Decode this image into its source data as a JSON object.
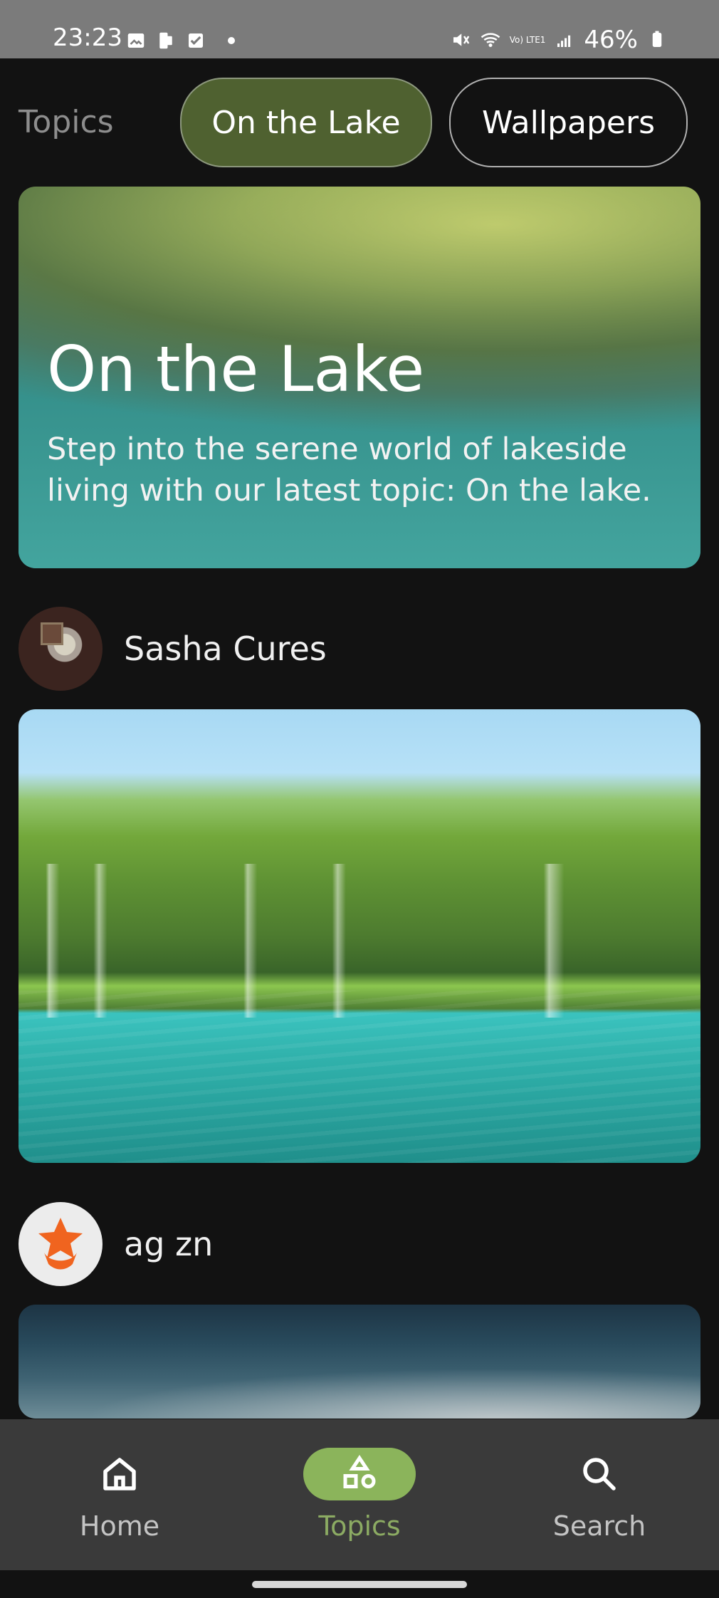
{
  "status_bar": {
    "time": "23:23",
    "battery": "46%",
    "network_label": "Vo) LTE1"
  },
  "header": {
    "title": "Topics",
    "chips": [
      {
        "label": "On the Lake",
        "selected": true
      },
      {
        "label": "Wallpapers",
        "selected": false
      }
    ]
  },
  "hero": {
    "title": "On the Lake",
    "description": "Step into the serene world of lakeside living with our latest topic: On the lake."
  },
  "feed": {
    "items": [
      {
        "author": "Sasha Cures"
      },
      {
        "author": "ag zn"
      }
    ]
  },
  "bottom_nav": {
    "items": [
      {
        "label": "Home"
      },
      {
        "label": "Topics"
      },
      {
        "label": "Search"
      }
    ]
  },
  "colors": {
    "background": "#121212",
    "active_chip": "#4f6130",
    "nav_active": "#8bb45b"
  }
}
